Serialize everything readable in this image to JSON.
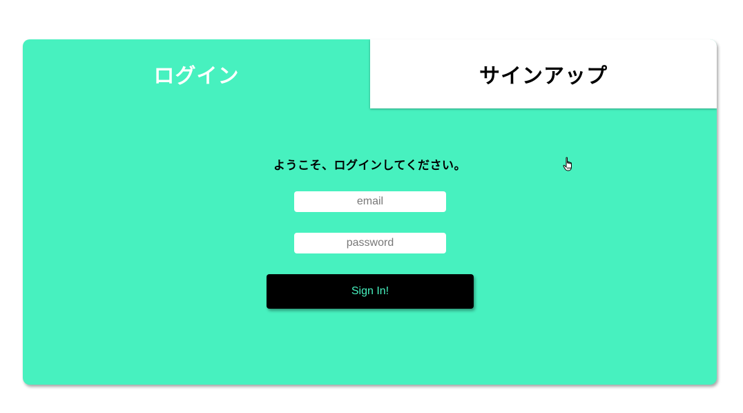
{
  "tabs": {
    "login_label": "ログイン",
    "signup_label": "サインアップ",
    "active": "login"
  },
  "form": {
    "welcome_text": "ようこそ、ログインしてください。",
    "email_placeholder": "email",
    "password_placeholder": "password",
    "submit_label": "Sign In!"
  },
  "colors": {
    "accent": "#47f1bf",
    "button_bg": "#000000",
    "inactive_tab_bg": "#ffffff"
  },
  "icons": {
    "cursor": "hand-pointer-icon"
  }
}
